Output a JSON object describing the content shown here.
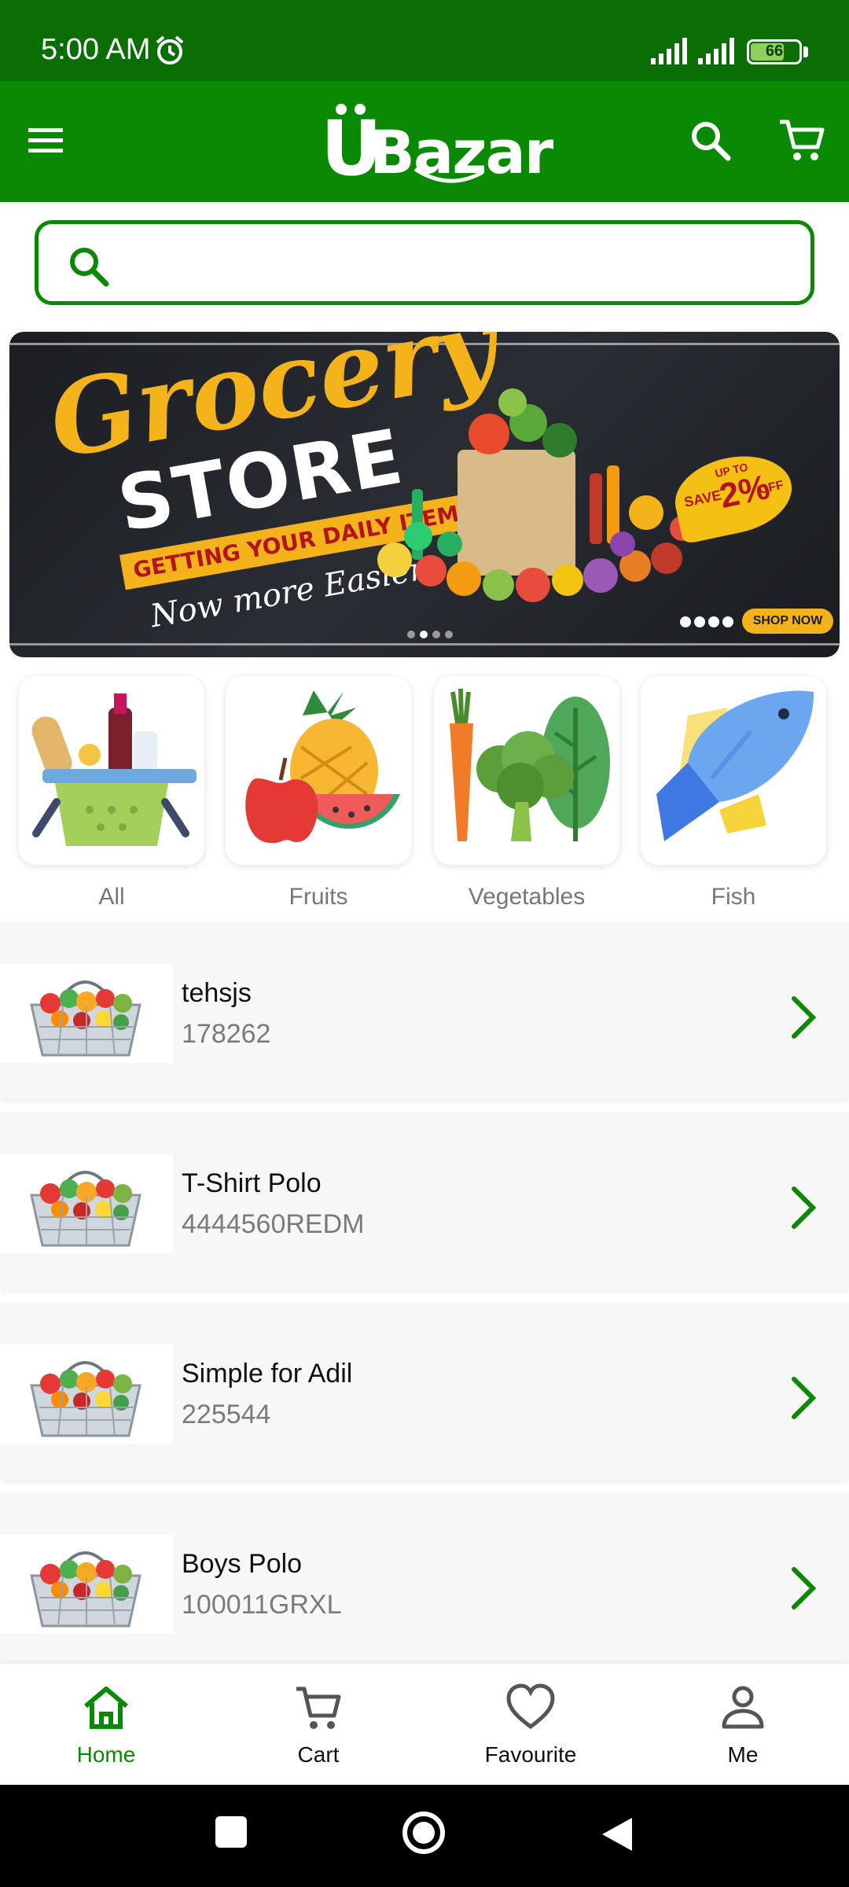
{
  "status_bar": {
    "time": "5:00 AM",
    "battery": "66",
    "battery_level": 0.66
  },
  "app_bar": {
    "logo_u": "U",
    "logo_text": "Bazar",
    "icons": [
      "menu-icon",
      "search-icon",
      "cart-icon"
    ]
  },
  "search": {
    "placeholder": "",
    "value": ""
  },
  "banner": {
    "title": "Grocery",
    "subtitle": "STORE",
    "ribbon": "GETTING YOUR DAILY ITEMS",
    "tagline": "Now more Easier",
    "save_prefix": "SAVE",
    "save_mid": "UP TO",
    "save_value": "2%",
    "save_suffix": "OFF",
    "cta": "SHOP NOW",
    "slides": 4,
    "active_slide": 1
  },
  "categories": [
    {
      "label": "All",
      "icon": "basket-icon"
    },
    {
      "label": "Fruits",
      "icon": "fruits-icon"
    },
    {
      "label": "Vegetables",
      "icon": "vegetables-icon"
    },
    {
      "label": "Fish",
      "icon": "fish-icon"
    }
  ],
  "products": [
    {
      "title": "tehsjs",
      "code": "178262"
    },
    {
      "title": "T-Shirt Polo",
      "code": "4444560REDM"
    },
    {
      "title": "Simple for Adil",
      "code": "225544"
    },
    {
      "title": "Boys Polo",
      "code": "100011GRXL"
    }
  ],
  "bottom_nav": [
    {
      "label": "Home",
      "icon": "home-icon",
      "active": true
    },
    {
      "label": "Cart",
      "icon": "cart-icon",
      "active": false
    },
    {
      "label": "Favourite",
      "icon": "heart-icon",
      "active": false
    },
    {
      "label": "Me",
      "icon": "person-icon",
      "active": false
    }
  ],
  "colors": {
    "primary": "#0a8a04",
    "status_bar": "#0b6e04",
    "accent": "#f5b31b"
  }
}
